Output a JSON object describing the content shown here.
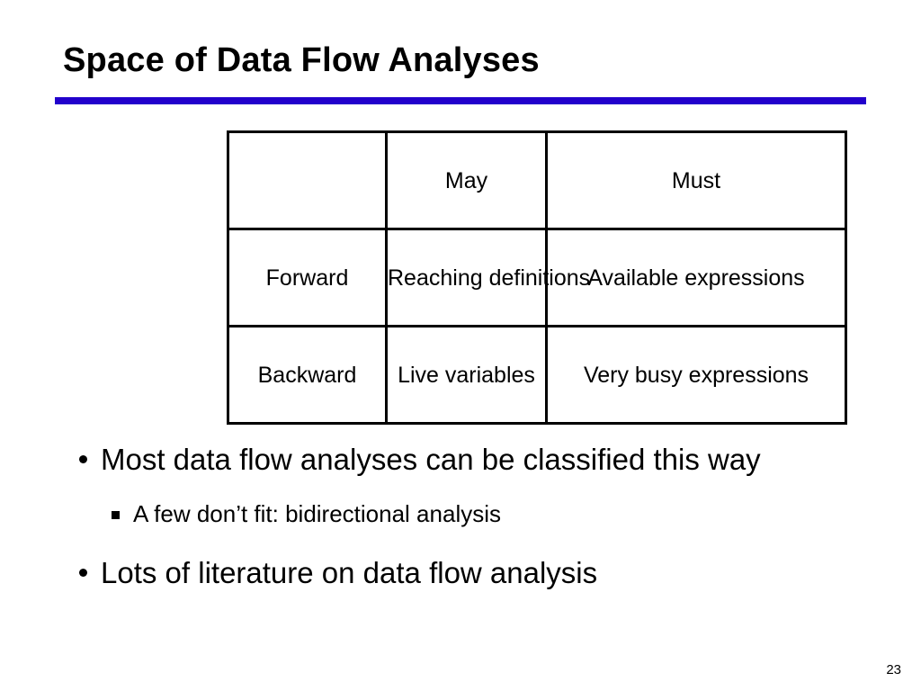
{
  "slide": {
    "title": "Space of Data Flow Analyses",
    "accent_color": "#2200CC",
    "page_number": "23"
  },
  "table": {
    "headers": [
      "",
      "May",
      "Must"
    ],
    "rows": [
      {
        "direction": "Forward",
        "may": "Reaching definitions",
        "must": "Available expressions"
      },
      {
        "direction": "Backward",
        "may": "Live variables",
        "must": "Very busy expressions"
      }
    ]
  },
  "bullets": [
    {
      "level": 1,
      "marker": "round-bullet",
      "text": "Most data flow analyses can be classified this way"
    },
    {
      "level": 2,
      "marker": "square-bullet",
      "text": "A few don’t fit:  bidirectional analysis"
    },
    {
      "level": 1,
      "marker": "round-bullet",
      "text": "Lots of literature on data flow analysis"
    }
  ]
}
